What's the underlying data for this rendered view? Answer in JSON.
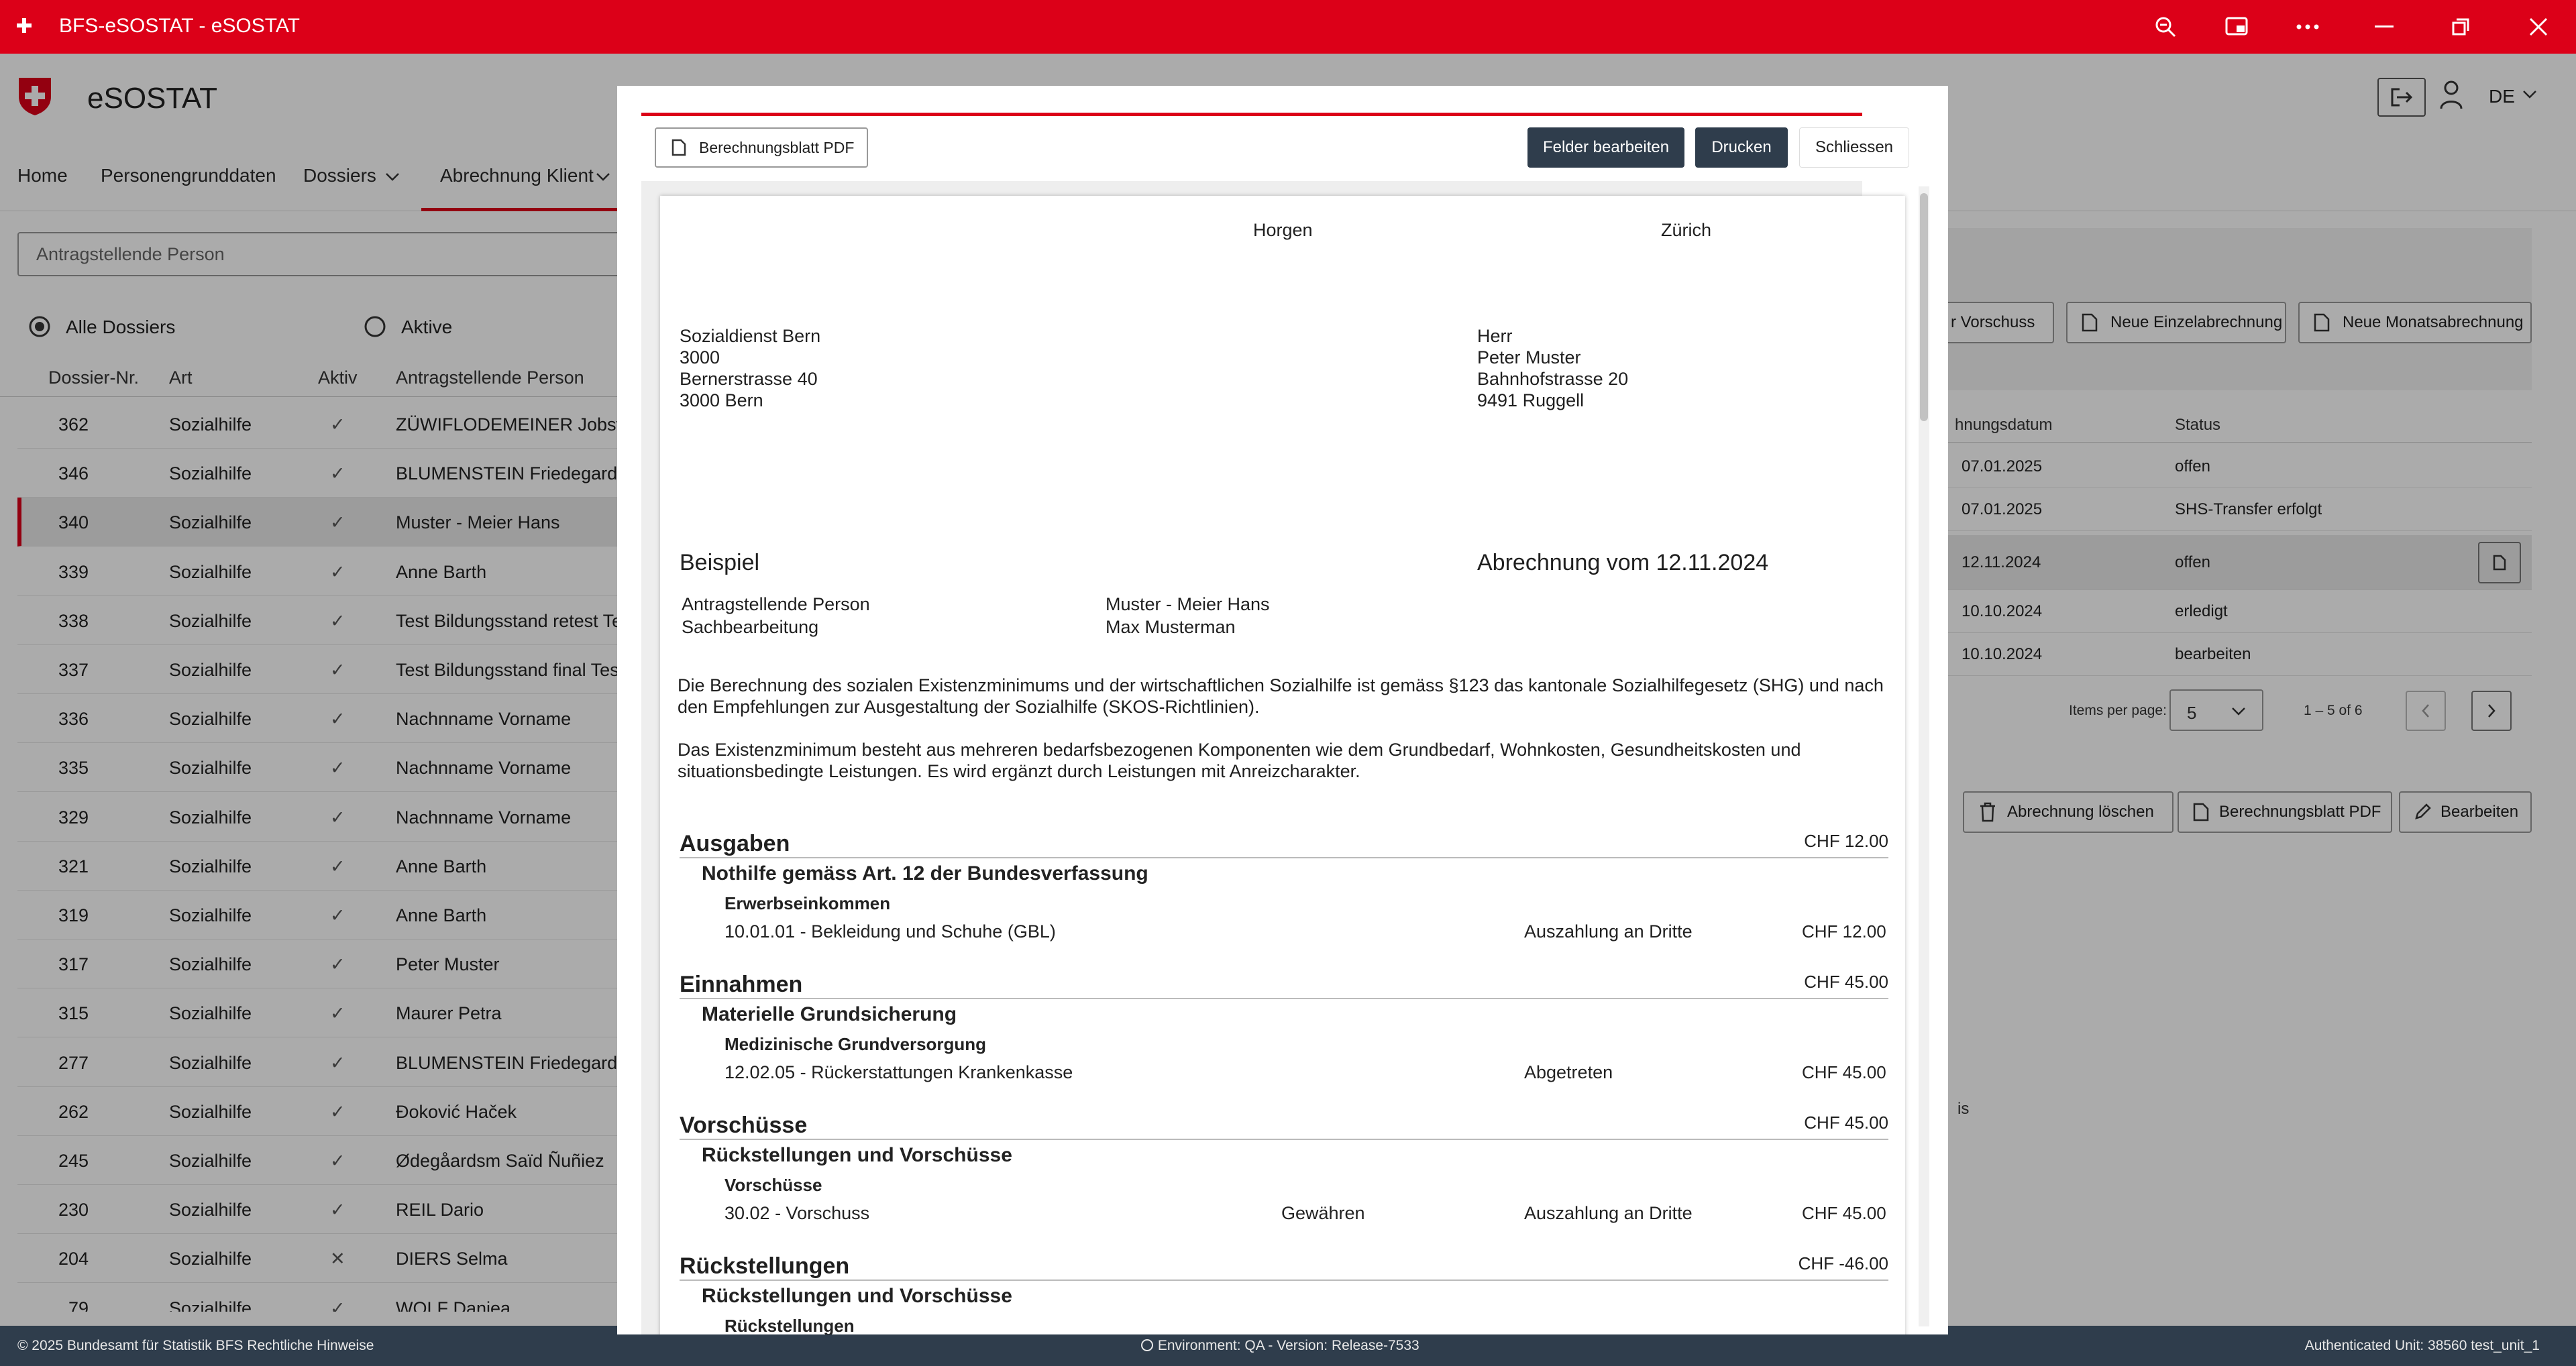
{
  "window": {
    "title": "BFS-eSOSTAT - eSOSTAT"
  },
  "app": {
    "name": "eSOSTAT",
    "lang": "DE"
  },
  "nav": {
    "home": "Home",
    "personen": "Personengrunddaten",
    "dossiers": "Dossiers",
    "abrechnung": "Abrechnung Klient"
  },
  "search": {
    "placeholder": "Antragstellende Person"
  },
  "filters": {
    "all": "Alle Dossiers",
    "active": "Aktive"
  },
  "dossier_table": {
    "headers": [
      "Dossier-Nr.",
      "Art",
      "Aktiv",
      "Antragstellende Person"
    ],
    "rows": [
      {
        "nr": "362",
        "art": "Sozialhilfe",
        "aktiv": "✓",
        "person": "ZÜWIFLODEMEINER Jobst"
      },
      {
        "nr": "346",
        "art": "Sozialhilfe",
        "aktiv": "✓",
        "person": "BLUMENSTEIN Friedegard"
      },
      {
        "nr": "340",
        "art": "Sozialhilfe",
        "aktiv": "✓",
        "person": "Muster - Meier Hans"
      },
      {
        "nr": "339",
        "art": "Sozialhilfe",
        "aktiv": "✓",
        "person": "Anne Barth"
      },
      {
        "nr": "338",
        "art": "Sozialhilfe",
        "aktiv": "✓",
        "person": "Test Bildungsstand retest Te"
      },
      {
        "nr": "337",
        "art": "Sozialhilfe",
        "aktiv": "✓",
        "person": "Test Bildungsstand final Tes"
      },
      {
        "nr": "336",
        "art": "Sozialhilfe",
        "aktiv": "✓",
        "person": "Nachnname Vorname"
      },
      {
        "nr": "335",
        "art": "Sozialhilfe",
        "aktiv": "✓",
        "person": "Nachnname Vorname"
      },
      {
        "nr": "329",
        "art": "Sozialhilfe",
        "aktiv": "✓",
        "person": "Nachnname Vorname"
      },
      {
        "nr": "321",
        "art": "Sozialhilfe",
        "aktiv": "✓",
        "person": "Anne Barth"
      },
      {
        "nr": "319",
        "art": "Sozialhilfe",
        "aktiv": "✓",
        "person": "Anne Barth"
      },
      {
        "nr": "317",
        "art": "Sozialhilfe",
        "aktiv": "✓",
        "person": "Peter Muster"
      },
      {
        "nr": "315",
        "art": "Sozialhilfe",
        "aktiv": "✓",
        "person": "Maurer Petra"
      },
      {
        "nr": "277",
        "art": "Sozialhilfe",
        "aktiv": "✓",
        "person": "BLUMENSTEIN Friedegard"
      },
      {
        "nr": "262",
        "art": "Sozialhilfe",
        "aktiv": "✓",
        "person": "Đoković Haček"
      },
      {
        "nr": "245",
        "art": "Sozialhilfe",
        "aktiv": "✓",
        "person": "Ødegåardsm Saïd Ñuñiez"
      },
      {
        "nr": "230",
        "art": "Sozialhilfe",
        "aktiv": "✓",
        "person": "REIL Dario"
      },
      {
        "nr": "204",
        "art": "Sozialhilfe",
        "aktiv": "✕",
        "person": "DIERS Selma"
      },
      {
        "nr": "79",
        "art": "Sozialhilfe",
        "aktiv": "✓",
        "person": "WOLF Daniea"
      }
    ]
  },
  "right_panel": {
    "buttons": {
      "vorschuss": "r Vorschuss",
      "einzel": "Neue Einzelabrechnung",
      "monat": "Neue Monatsabrechnung"
    },
    "headers": [
      "hnungsdatum",
      "Status"
    ],
    "rows": [
      {
        "datum": "07.01.2025",
        "status": "offen"
      },
      {
        "datum": "07.01.2025",
        "status": "SHS-Transfer erfolgt"
      },
      {
        "datum": "12.11.2024",
        "status": "offen"
      },
      {
        "datum": "10.10.2024",
        "status": "erledigt"
      },
      {
        "datum": "10.10.2024",
        "status": "bearbeiten"
      }
    ],
    "paginator": {
      "label": "Items per page:",
      "value": "5",
      "range": "1 – 5 of 6"
    },
    "actions": {
      "loeschen": "Abrechnung löschen",
      "pdf": "Berechnungsblatt PDF",
      "bearbeiten": "Bearbeiten"
    },
    "fragment": "is"
  },
  "modal": {
    "pdf_button": "Berechnungsblatt PDF",
    "edit_button": "Felder bearbeiten",
    "print_button": "Drucken",
    "close_button": "Schliessen",
    "doc": {
      "place_left": "Horgen",
      "place_right": "Zürich",
      "sender": [
        "Sozialdienst Bern",
        "3000",
        "Bernerstrasse 40",
        "3000 Bern"
      ],
      "recipient": [
        "Herr",
        "Peter Muster",
        "Bahnhofstrasse 20",
        "9491 Ruggell"
      ],
      "title": "Beispiel",
      "date_title": "Abrechnung vom 12.11.2024",
      "meta": [
        {
          "label": "Antragstellende Person",
          "value": "Muster - Meier Hans"
        },
        {
          "label": "Sachbearbeitung",
          "value": "Max Musterman"
        }
      ],
      "para1": "Die Berechnung des sozialen Existenzminimums und der wirtschaftlichen Sozialhilfe ist gemäss §123 das kantonale Sozialhilfegesetz (SHG) und nach den Empfehlungen zur Ausgestaltung der Sozialhilfe (SKOS-Richtlinien).",
      "para2": "Das Existenzminimum besteht aus mehreren bedarfsbezogenen Komponenten wie dem Grundbedarf, Wohnkosten, Gesundheitskosten und situationsbedingte Leistungen. Es wird ergänzt durch Leistungen mit Anreizcharakter.",
      "sections": [
        {
          "title": "Ausgaben",
          "amount": "CHF 12.00",
          "sub": "Nothilfe gemäss Art. 12 der Bundesverfassung",
          "cat": "Erwerbseinkommen",
          "item": "10.01.01 - Bekleidung und Schuhe (GBL)",
          "mid": "",
          "note": "Auszahlung an Dritte",
          "value": "CHF 12.00"
        },
        {
          "title": "Einnahmen",
          "amount": "CHF 45.00",
          "sub": "Materielle Grundsicherung",
          "cat": "Medizinische Grundversorgung",
          "item": "12.02.05 - Rückerstattungen Krankenkasse",
          "mid": "",
          "note": "Abgetreten",
          "value": "CHF 45.00"
        },
        {
          "title": "Vorschüsse",
          "amount": "CHF 45.00",
          "sub": "Rückstellungen und Vorschüsse",
          "cat": "Vorschüsse",
          "item": "30.02 - Vorschuss",
          "mid": "Gewähren",
          "note": "Auszahlung an Dritte",
          "value": "CHF 45.00"
        },
        {
          "title": "Rückstellungen",
          "amount": "CHF -46.00",
          "sub": "Rückstellungen und Vorschüsse",
          "cat": "Rückstellungen",
          "item": "",
          "mid": "",
          "note": "",
          "value": ""
        }
      ]
    }
  },
  "footer": {
    "left": "© 2025 Bundesamt für Statistik BFS Rechtliche Hinweise",
    "center": "Environment: QA - Version: Release-7533",
    "right": "Authenticated Unit: 38560 test_unit_1"
  },
  "colors": {
    "brand_red": "#dc0018",
    "dark": "#2f3d4c"
  }
}
